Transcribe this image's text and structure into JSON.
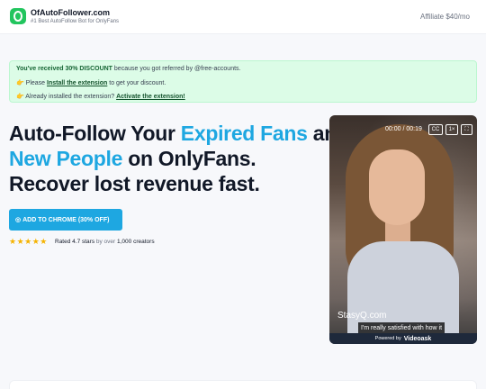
{
  "header": {
    "brand": "OfAutoFollower.com",
    "tagline": "#1 Best AutoFollow Bot for OnlyFans",
    "affiliate": "Affiliate $40/mo",
    "logo_icon": "shield-lock-icon"
  },
  "promo": {
    "line1_bold": "You've received 30% DISCOUNT",
    "line1_rest": " because you got referred by @free-accounts.",
    "line2_emoji": "👉",
    "line2_pre": " Please ",
    "line2_link": "Install the extension",
    "line2_post": " to get your discount.",
    "line3_emoji": "👉",
    "line3_pre": " Already installed the extension? ",
    "line3_link": "Activate the extension!"
  },
  "hero": {
    "line1_a": "Auto-Follow Your ",
    "line1_hl": "Expired Fans",
    "line1_b": " and",
    "line2_hl": "New People",
    "line2_b": " on OnlyFans.",
    "line3": "Recover lost revenue fast.",
    "highlight_color": "#1ea7e1"
  },
  "cta": {
    "icon": "chrome-icon",
    "label": "ADD TO CHROME (30% OFF)",
    "color": "#1ea7e1"
  },
  "rating": {
    "stars": "★★★★★",
    "star_count": 5,
    "text_a": "Rated 4.7 stars",
    "text_b": " by over ",
    "text_c": "1,000 creators"
  },
  "video": {
    "time": "00:00 / 00:19",
    "cc": "CC",
    "speed": "1×",
    "fullscreen_icon": "fullscreen-icon",
    "watermark": "StasyQ.com",
    "caption": "I'm really satisfied with how it",
    "powered_by": "Powered by",
    "powered_brand": "Videoask"
  }
}
